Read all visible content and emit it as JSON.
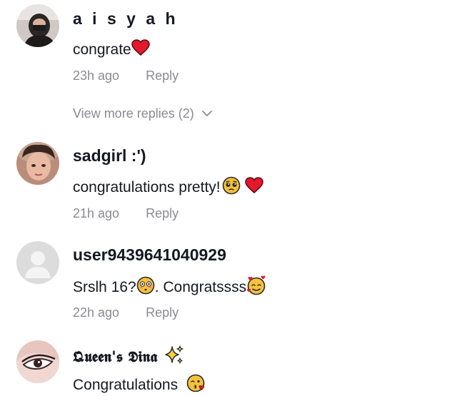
{
  "comments": [
    {
      "username": "a i s y a h",
      "text": "congrate",
      "emojis": [
        "red-heart-icon"
      ],
      "time": "23h ago",
      "reply_label": "Reply",
      "view_more": "View more replies (2)"
    },
    {
      "username": "sadgirl :')",
      "text": "congratulations pretty!",
      "emojis": [
        "pleading-face-icon",
        "red-heart-icon"
      ],
      "time": "21h ago",
      "reply_label": "Reply"
    },
    {
      "username": "user9439641040929",
      "text_before": "Srslh 16?",
      "text_after": ". Congratssss",
      "emojis": [
        "flushed-face-icon",
        "smiling-face-with-hearts-icon"
      ],
      "time": "22h ago",
      "reply_label": "Reply"
    },
    {
      "username": "𝕼𝖚𝖊𝖊𝖓'𝖘 𝕯𝖎𝖓𝖆",
      "text": "Congratulations ",
      "emojis": [
        "sparkles-icon",
        "face-blowing-kiss-icon"
      ]
    }
  ],
  "colors": {
    "primary_text": "#161823",
    "secondary_text": "#8a8b91",
    "heart": "#e3192c",
    "emoji_yellow": "#f7c23a"
  }
}
